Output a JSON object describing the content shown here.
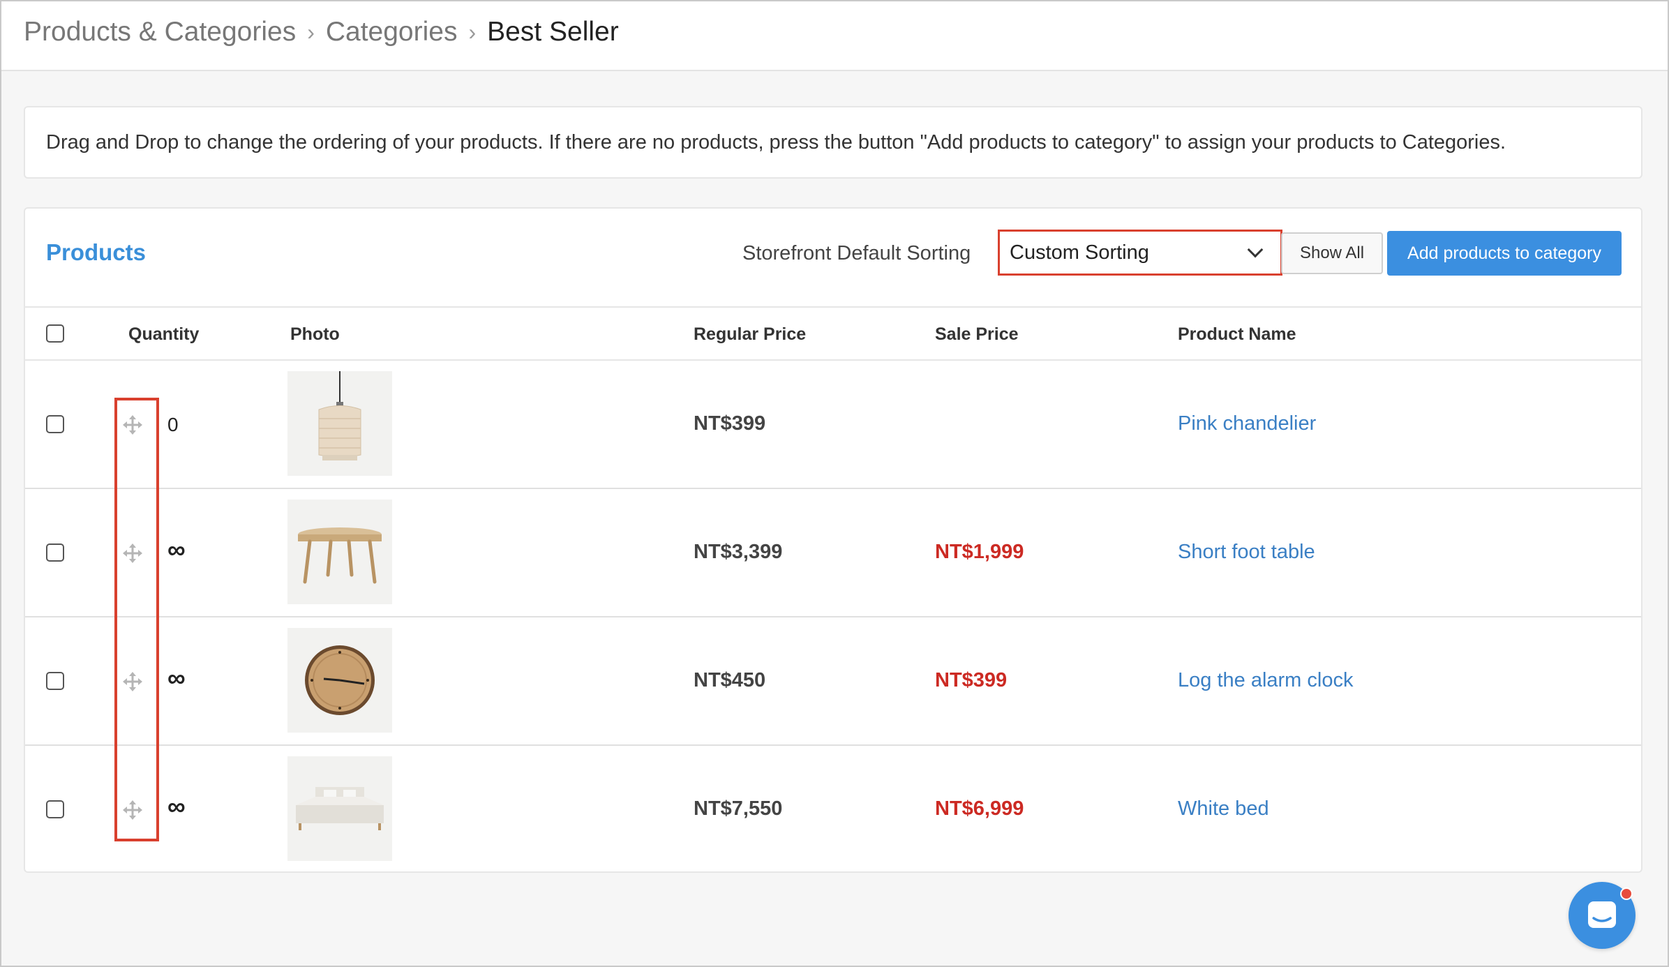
{
  "breadcrumb": {
    "items": [
      "Products & Categories",
      "Categories"
    ],
    "current": "Best Seller"
  },
  "info": {
    "text": "Drag and Drop to change the ordering of your products. If there are no products, press the button \"Add products to category\" to assign your products to Categories."
  },
  "panel": {
    "title": "Products",
    "sort_label": "Storefront Default Sorting",
    "sort_value": "Custom Sorting",
    "show_all_label": "Show All",
    "add_button_label": "Add products to category"
  },
  "table": {
    "headers": {
      "quantity": "Quantity",
      "photo": "Photo",
      "regular_price": "Regular Price",
      "sale_price": "Sale Price",
      "product_name": "Product Name"
    },
    "rows": [
      {
        "quantity": "0",
        "photo_icon": "pendant-lamp-icon",
        "regular_price": "NT$399",
        "sale_price": "",
        "name": "Pink chandelier"
      },
      {
        "quantity": "∞",
        "photo_icon": "table-icon",
        "regular_price": "NT$3,399",
        "sale_price": "NT$1,999",
        "name": "Short foot table"
      },
      {
        "quantity": "∞",
        "photo_icon": "wall-clock-icon",
        "regular_price": "NT$450",
        "sale_price": "NT$399",
        "name": "Log the alarm clock"
      },
      {
        "quantity": "∞",
        "photo_icon": "bed-icon",
        "regular_price": "NT$7,550",
        "sale_price": "NT$6,999",
        "name": "White bed"
      }
    ]
  },
  "colors": {
    "accent": "#3b8fe0",
    "sale": "#cc2a23",
    "highlight": "#d9402e",
    "link": "#3a7fc4"
  }
}
